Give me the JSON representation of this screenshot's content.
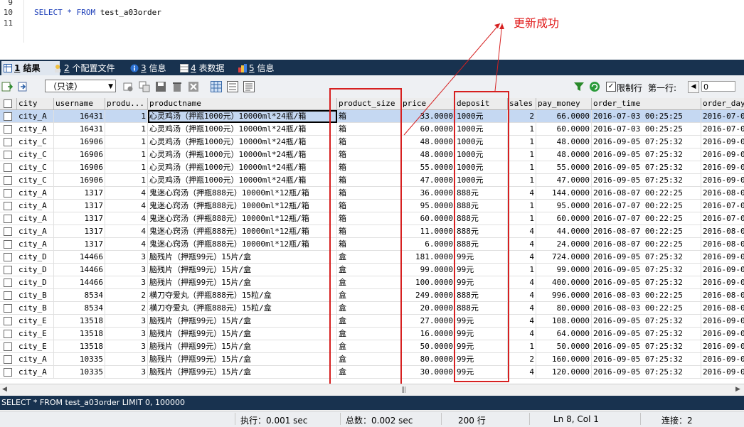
{
  "editor": {
    "line_numbers": [
      "9",
      "10",
      "11"
    ],
    "sql": {
      "kw1": "SELECT",
      "star": " * ",
      "kw2": "FROM",
      "table": " test_a03order"
    }
  },
  "annotation": {
    "text": "更新成功"
  },
  "tabs": [
    {
      "num": "1",
      "label": " 结果",
      "icon": "result-grid-icon"
    },
    {
      "num": "2",
      "label": " 个配置文件",
      "icon": "profile-icon"
    },
    {
      "num": "3",
      "label": " 信息",
      "icon": "info-icon"
    },
    {
      "num": "4",
      "label": " 表数据",
      "icon": "table-data-icon"
    },
    {
      "num": "5",
      "label": " 信息",
      "icon": "info-icon"
    }
  ],
  "toolbar": {
    "readonly_label": "（只读）",
    "limit_label": "限制行",
    "first_row_label": "第一行:",
    "first_row_value": "0"
  },
  "grid": {
    "columns": [
      "city",
      "username",
      "produ...",
      "productname",
      "product_size",
      "price",
      "deposit",
      "sales",
      "pay_money",
      "order_time",
      "order_day"
    ],
    "rows": [
      [
        "city_A",
        "16431",
        "1",
        "心灵鸡汤（押瓶1000元）10000ml*24瓶/箱",
        "箱",
        "33.0000",
        "1000元",
        "2",
        "66.0000",
        "2016-07-03 00:25:25",
        "2016-07-0"
      ],
      [
        "city_A",
        "16431",
        "1",
        "心灵鸡汤（押瓶1000元）10000ml*24瓶/箱",
        "箱",
        "60.0000",
        "1000元",
        "1",
        "60.0000",
        "2016-07-03 00:25:25",
        "2016-07-0"
      ],
      [
        "city_C",
        "16906",
        "1",
        "心灵鸡汤（押瓶1000元）10000ml*24瓶/箱",
        "箱",
        "48.0000",
        "1000元",
        "1",
        "48.0000",
        "2016-09-05 07:25:32",
        "2016-09-0"
      ],
      [
        "city_C",
        "16906",
        "1",
        "心灵鸡汤（押瓶1000元）10000ml*24瓶/箱",
        "箱",
        "48.0000",
        "1000元",
        "1",
        "48.0000",
        "2016-09-05 07:25:32",
        "2016-09-0"
      ],
      [
        "city_C",
        "16906",
        "1",
        "心灵鸡汤（押瓶1000元）10000ml*24瓶/箱",
        "箱",
        "55.0000",
        "1000元",
        "1",
        "55.0000",
        "2016-09-05 07:25:32",
        "2016-09-0"
      ],
      [
        "city_C",
        "16906",
        "1",
        "心灵鸡汤（押瓶1000元）10000ml*24瓶/箱",
        "箱",
        "47.0000",
        "1000元",
        "1",
        "47.0000",
        "2016-09-05 07:25:32",
        "2016-09-0"
      ],
      [
        "city_A",
        "1317",
        "4",
        "鬼迷心窍汤（押瓶888元）10000ml*12瓶/箱",
        "箱",
        "36.0000",
        "888元",
        "4",
        "144.0000",
        "2016-08-07 00:22:25",
        "2016-08-0"
      ],
      [
        "city_A",
        "1317",
        "4",
        "鬼迷心窍汤（押瓶888元）10000ml*12瓶/箱",
        "箱",
        "95.0000",
        "888元",
        "1",
        "95.0000",
        "2016-07-07 00:22:25",
        "2016-07-0"
      ],
      [
        "city_A",
        "1317",
        "4",
        "鬼迷心窍汤（押瓶888元）10000ml*12瓶/箱",
        "箱",
        "60.0000",
        "888元",
        "1",
        "60.0000",
        "2016-07-07 00:22:25",
        "2016-07-0"
      ],
      [
        "city_A",
        "1317",
        "4",
        "鬼迷心窍汤（押瓶888元）10000ml*12瓶/箱",
        "箱",
        "11.0000",
        "888元",
        "4",
        "44.0000",
        "2016-08-07 00:22:25",
        "2016-08-0"
      ],
      [
        "city_A",
        "1317",
        "4",
        "鬼迷心窍汤（押瓶888元）10000ml*12瓶/箱",
        "箱",
        "6.0000",
        "888元",
        "4",
        "24.0000",
        "2016-08-07 00:22:25",
        "2016-08-0"
      ],
      [
        "city_D",
        "14466",
        "3",
        "脑残片（押瓶99元）15片/盒",
        "盒",
        "181.0000",
        "99元",
        "4",
        "724.0000",
        "2016-09-05 07:25:32",
        "2016-09-0"
      ],
      [
        "city_D",
        "14466",
        "3",
        "脑残片（押瓶99元）15片/盒",
        "盒",
        "99.0000",
        "99元",
        "1",
        "99.0000",
        "2016-09-05 07:25:32",
        "2016-09-0"
      ],
      [
        "city_D",
        "14466",
        "3",
        "脑残片（押瓶99元）15片/盒",
        "盒",
        "100.0000",
        "99元",
        "4",
        "400.0000",
        "2016-09-05 07:25:32",
        "2016-09-0"
      ],
      [
        "city_B",
        "8534",
        "2",
        "横刀夺爱丸（押瓶888元）15粒/盒",
        "盒",
        "249.0000",
        "888元",
        "4",
        "996.0000",
        "2016-08-03 00:22:25",
        "2016-08-0"
      ],
      [
        "city_B",
        "8534",
        "2",
        "横刀夺爱丸（押瓶888元）15粒/盒",
        "盒",
        "20.0000",
        "888元",
        "4",
        "80.0000",
        "2016-08-03 00:22:25",
        "2016-08-0"
      ],
      [
        "city_E",
        "13518",
        "3",
        "脑残片（押瓶99元）15片/盒",
        "盒",
        "27.0000",
        "99元",
        "4",
        "108.0000",
        "2016-09-05 07:25:32",
        "2016-09-0"
      ],
      [
        "city_E",
        "13518",
        "3",
        "脑残片（押瓶99元）15片/盒",
        "盒",
        "16.0000",
        "99元",
        "4",
        "64.0000",
        "2016-09-05 07:25:32",
        "2016-09-0"
      ],
      [
        "city_E",
        "13518",
        "3",
        "脑残片（押瓶99元）15片/盒",
        "盒",
        "50.0000",
        "99元",
        "1",
        "50.0000",
        "2016-09-05 07:25:32",
        "2016-09-0"
      ],
      [
        "city_A",
        "10335",
        "3",
        "脑残片（押瓶99元）15片/盒",
        "盒",
        "80.0000",
        "99元",
        "2",
        "160.0000",
        "2016-09-05 07:25:32",
        "2016-09-0"
      ],
      [
        "city_A",
        "10335",
        "3",
        "脑残片（押瓶99元）15片/盒",
        "盒",
        "30.0000",
        "99元",
        "4",
        "120.0000",
        "2016-09-05 07:25:32",
        "2016-09-0"
      ]
    ]
  },
  "sql_status": "SELECT * FROM test_a03order LIMIT 0, 100000",
  "status": {
    "exec_time": "执行：0.001 sec",
    "total_time": "总数：0.002 sec",
    "rows": "200 行",
    "position": "Ln 8, Col 1",
    "connection": "连接：2"
  },
  "colors": {
    "annotation_red": "#d62020",
    "tabbar": "#18324f",
    "selected_row": "#c5d8f2"
  }
}
